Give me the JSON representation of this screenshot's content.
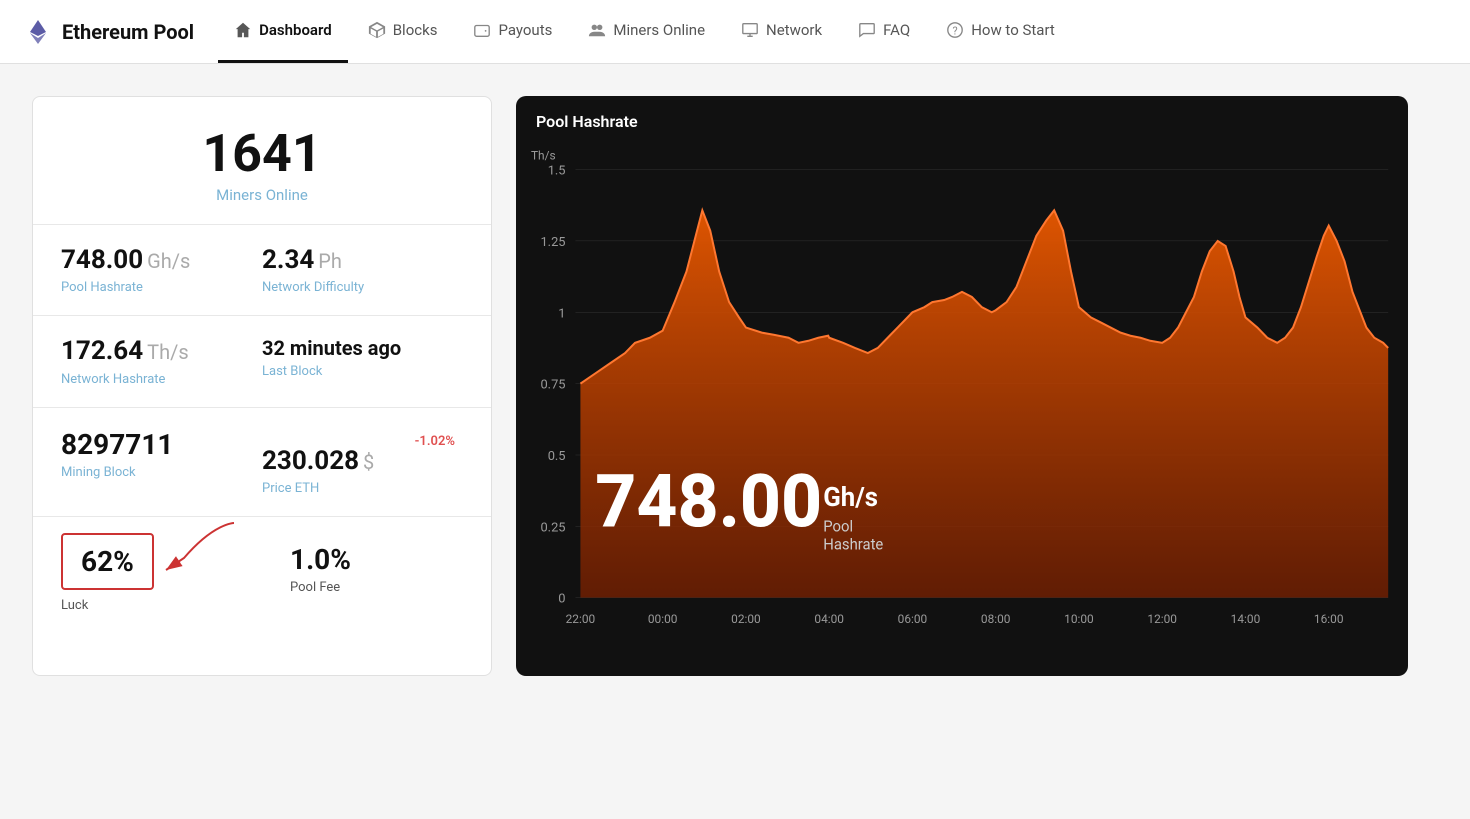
{
  "brand": {
    "name": "Ethereum Pool"
  },
  "nav": {
    "items": [
      {
        "id": "dashboard",
        "label": "Dashboard",
        "icon": "home",
        "active": true
      },
      {
        "id": "blocks",
        "label": "Blocks",
        "icon": "cube"
      },
      {
        "id": "payouts",
        "label": "Payouts",
        "icon": "wallet"
      },
      {
        "id": "miners-online",
        "label": "Miners Online",
        "icon": "users"
      },
      {
        "id": "network",
        "label": "Network",
        "icon": "monitor"
      },
      {
        "id": "faq",
        "label": "FAQ",
        "icon": "chat"
      },
      {
        "id": "how-to-start",
        "label": "How to Start",
        "icon": "question"
      }
    ]
  },
  "stats": {
    "miners_count": "1641",
    "miners_label_1": "Miners",
    "miners_label_2": "Online",
    "pool_hashrate_value": "748.00",
    "pool_hashrate_unit": "Gh/s",
    "pool_hashrate_label_1": "Pool",
    "pool_hashrate_label_2": "Hashrate",
    "network_difficulty_value": "2.34",
    "network_difficulty_unit": "Ph",
    "network_difficulty_label_1": "Network",
    "network_difficulty_label_2": "Difficulty",
    "network_hashrate_value": "172.64",
    "network_hashrate_unit": "Th/s",
    "network_hashrate_label_1": "Network",
    "network_hashrate_label_2": "Hashrate",
    "last_block_value": "32 minutes ago",
    "last_block_label_1": "Last",
    "last_block_label_2": "Block",
    "mining_block_value": "8297711",
    "mining_block_label_1": "Mining",
    "mining_block_label_2": "Block",
    "price_change": "-1.02%",
    "price_value": "230.028",
    "price_unit": "$",
    "price_label_1": "Price",
    "price_label_2": "ETH",
    "luck_value": "62%",
    "luck_label": "Luck",
    "pool_fee_value": "1.0%",
    "pool_fee_label": "Pool Fee"
  },
  "chart": {
    "title": "Pool Hashrate",
    "y_label": "Th/s",
    "y_ticks": [
      "0",
      "0.25",
      "0.5",
      "0.75",
      "1",
      "1.25",
      "1.5"
    ],
    "x_ticks": [
      "22:00",
      "00:00",
      "02:00",
      "04:00",
      "06:00",
      "08:00",
      "10:00",
      "12:00",
      "14:00",
      "16:00"
    ],
    "overlay_value": "748.00",
    "overlay_unit": "Gh/s",
    "overlay_label_1": "Pool",
    "overlay_label_2": "Hashrate",
    "accent_color": "#c84b00"
  }
}
